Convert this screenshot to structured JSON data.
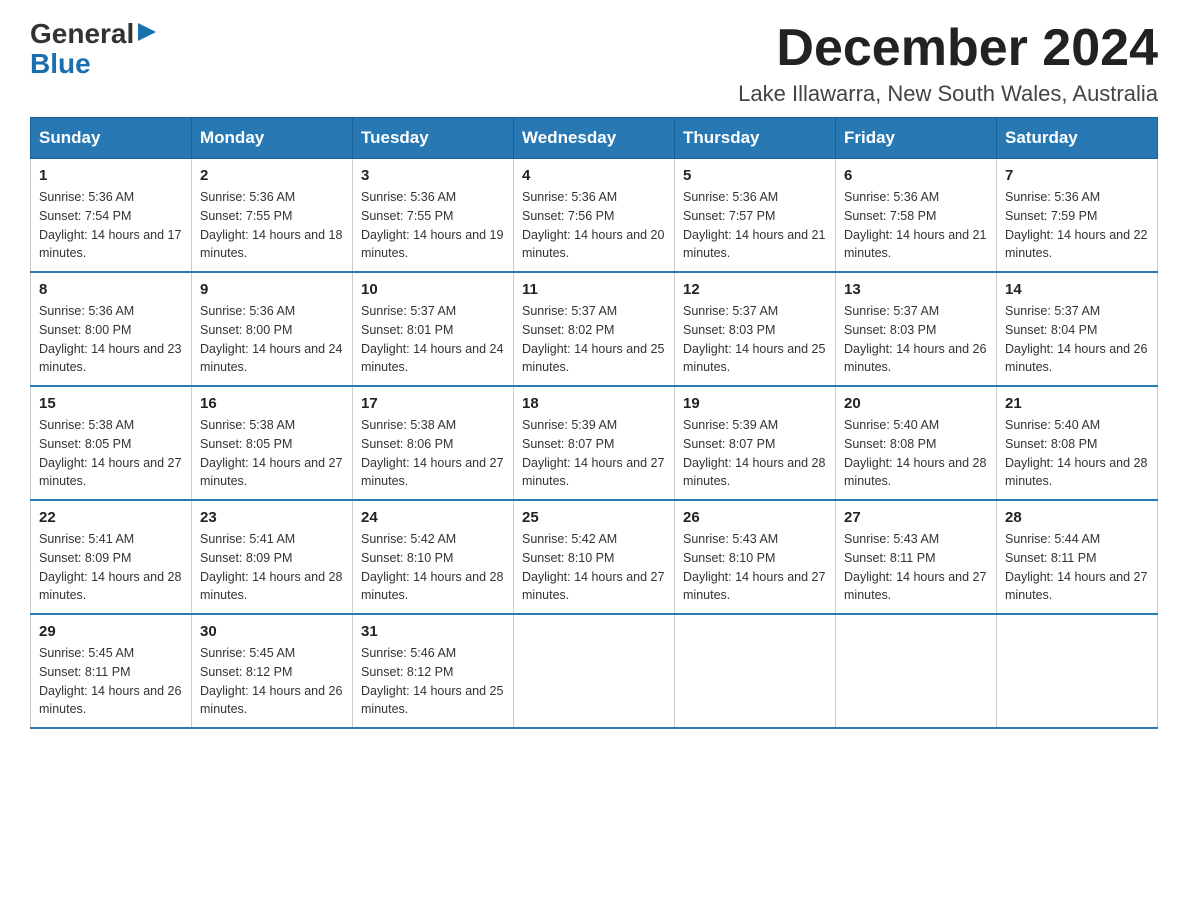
{
  "header": {
    "logo_general": "General",
    "logo_blue": "Blue",
    "month_title": "December 2024",
    "location": "Lake Illawarra, New South Wales, Australia"
  },
  "weekdays": [
    "Sunday",
    "Monday",
    "Tuesday",
    "Wednesday",
    "Thursday",
    "Friday",
    "Saturday"
  ],
  "weeks": [
    [
      {
        "day": "1",
        "sunrise": "5:36 AM",
        "sunset": "7:54 PM",
        "daylight": "14 hours and 17 minutes."
      },
      {
        "day": "2",
        "sunrise": "5:36 AM",
        "sunset": "7:55 PM",
        "daylight": "14 hours and 18 minutes."
      },
      {
        "day": "3",
        "sunrise": "5:36 AM",
        "sunset": "7:55 PM",
        "daylight": "14 hours and 19 minutes."
      },
      {
        "day": "4",
        "sunrise": "5:36 AM",
        "sunset": "7:56 PM",
        "daylight": "14 hours and 20 minutes."
      },
      {
        "day": "5",
        "sunrise": "5:36 AM",
        "sunset": "7:57 PM",
        "daylight": "14 hours and 21 minutes."
      },
      {
        "day": "6",
        "sunrise": "5:36 AM",
        "sunset": "7:58 PM",
        "daylight": "14 hours and 21 minutes."
      },
      {
        "day": "7",
        "sunrise": "5:36 AM",
        "sunset": "7:59 PM",
        "daylight": "14 hours and 22 minutes."
      }
    ],
    [
      {
        "day": "8",
        "sunrise": "5:36 AM",
        "sunset": "8:00 PM",
        "daylight": "14 hours and 23 minutes."
      },
      {
        "day": "9",
        "sunrise": "5:36 AM",
        "sunset": "8:00 PM",
        "daylight": "14 hours and 24 minutes."
      },
      {
        "day": "10",
        "sunrise": "5:37 AM",
        "sunset": "8:01 PM",
        "daylight": "14 hours and 24 minutes."
      },
      {
        "day": "11",
        "sunrise": "5:37 AM",
        "sunset": "8:02 PM",
        "daylight": "14 hours and 25 minutes."
      },
      {
        "day": "12",
        "sunrise": "5:37 AM",
        "sunset": "8:03 PM",
        "daylight": "14 hours and 25 minutes."
      },
      {
        "day": "13",
        "sunrise": "5:37 AM",
        "sunset": "8:03 PM",
        "daylight": "14 hours and 26 minutes."
      },
      {
        "day": "14",
        "sunrise": "5:37 AM",
        "sunset": "8:04 PM",
        "daylight": "14 hours and 26 minutes."
      }
    ],
    [
      {
        "day": "15",
        "sunrise": "5:38 AM",
        "sunset": "8:05 PM",
        "daylight": "14 hours and 27 minutes."
      },
      {
        "day": "16",
        "sunrise": "5:38 AM",
        "sunset": "8:05 PM",
        "daylight": "14 hours and 27 minutes."
      },
      {
        "day": "17",
        "sunrise": "5:38 AM",
        "sunset": "8:06 PM",
        "daylight": "14 hours and 27 minutes."
      },
      {
        "day": "18",
        "sunrise": "5:39 AM",
        "sunset": "8:07 PM",
        "daylight": "14 hours and 27 minutes."
      },
      {
        "day": "19",
        "sunrise": "5:39 AM",
        "sunset": "8:07 PM",
        "daylight": "14 hours and 28 minutes."
      },
      {
        "day": "20",
        "sunrise": "5:40 AM",
        "sunset": "8:08 PM",
        "daylight": "14 hours and 28 minutes."
      },
      {
        "day": "21",
        "sunrise": "5:40 AM",
        "sunset": "8:08 PM",
        "daylight": "14 hours and 28 minutes."
      }
    ],
    [
      {
        "day": "22",
        "sunrise": "5:41 AM",
        "sunset": "8:09 PM",
        "daylight": "14 hours and 28 minutes."
      },
      {
        "day": "23",
        "sunrise": "5:41 AM",
        "sunset": "8:09 PM",
        "daylight": "14 hours and 28 minutes."
      },
      {
        "day": "24",
        "sunrise": "5:42 AM",
        "sunset": "8:10 PM",
        "daylight": "14 hours and 28 minutes."
      },
      {
        "day": "25",
        "sunrise": "5:42 AM",
        "sunset": "8:10 PM",
        "daylight": "14 hours and 27 minutes."
      },
      {
        "day": "26",
        "sunrise": "5:43 AM",
        "sunset": "8:10 PM",
        "daylight": "14 hours and 27 minutes."
      },
      {
        "day": "27",
        "sunrise": "5:43 AM",
        "sunset": "8:11 PM",
        "daylight": "14 hours and 27 minutes."
      },
      {
        "day": "28",
        "sunrise": "5:44 AM",
        "sunset": "8:11 PM",
        "daylight": "14 hours and 27 minutes."
      }
    ],
    [
      {
        "day": "29",
        "sunrise": "5:45 AM",
        "sunset": "8:11 PM",
        "daylight": "14 hours and 26 minutes."
      },
      {
        "day": "30",
        "sunrise": "5:45 AM",
        "sunset": "8:12 PM",
        "daylight": "14 hours and 26 minutes."
      },
      {
        "day": "31",
        "sunrise": "5:46 AM",
        "sunset": "8:12 PM",
        "daylight": "14 hours and 25 minutes."
      },
      null,
      null,
      null,
      null
    ]
  ]
}
